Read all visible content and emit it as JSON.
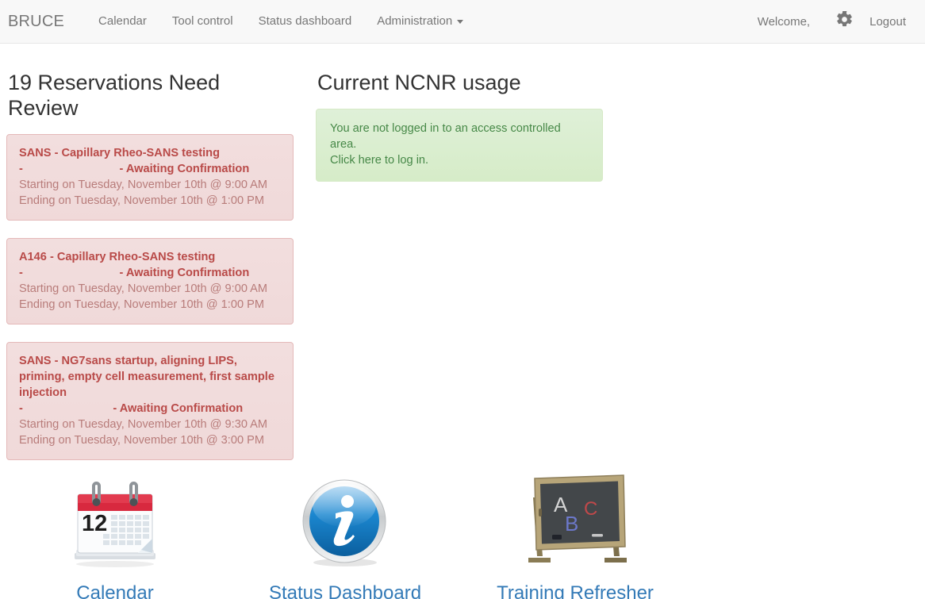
{
  "navbar": {
    "brand": "BRUCE",
    "links": [
      {
        "label": "Calendar",
        "name": "nav-calendar"
      },
      {
        "label": "Tool control",
        "name": "nav-tool-control"
      },
      {
        "label": "Status dashboard",
        "name": "nav-status-dashboard"
      },
      {
        "label": "Administration",
        "name": "nav-administration",
        "caret": true
      }
    ],
    "welcome": "Welcome,",
    "settings_icon": "gear-icon",
    "logout": "Logout"
  },
  "reservations": {
    "heading": "19 Reservations Need Review",
    "items": [
      {
        "title": "SANS - Capillary Rheo-SANS testing",
        "person": "-                              - Awaiting Confirmation",
        "start": "Starting on Tuesday, November 10th @ 9:00 AM",
        "end": "Ending on Tuesday, November 10th @ 1:00 PM"
      },
      {
        "title": "A146 - Capillary Rheo-SANS testing",
        "person": "-                              - Awaiting Confirmation",
        "start": "Starting on Tuesday, November 10th @ 9:00 AM",
        "end": "Ending on Tuesday, November 10th @ 1:00 PM"
      },
      {
        "title": "SANS - NG7sans startup, aligning LIPS, priming, empty cell measurement, first sample injection",
        "person": "-                            - Awaiting Confirmation",
        "start": "Starting on Tuesday, November 10th @ 9:30 AM",
        "end": "Ending on Tuesday, November 10th @ 3:00 PM"
      }
    ]
  },
  "usage": {
    "heading": "Current NCNR usage",
    "line1": "You are not logged in to an access controlled area.",
    "line2": "Click here to log in."
  },
  "tiles": [
    {
      "label": "Calendar",
      "icon": "calendar-icon"
    },
    {
      "label": "Status Dashboard",
      "icon": "info-circle-icon"
    },
    {
      "label": "Training Refresher",
      "icon": "chalkboard-icon"
    }
  ],
  "colors": {
    "navbar_bg": "#f8f8f8",
    "nav_text": "#777777",
    "page_bg": "#ffffff",
    "heading": "#333333",
    "alert_danger_bg": "#f2dede",
    "alert_danger_border": "#e4b9b9",
    "alert_danger_text": "#b94a48",
    "alert_success_bg": "#dff0d8",
    "alert_success_border": "#d6e9c6",
    "alert_success_text": "#468847",
    "link": "#337ab7"
  }
}
